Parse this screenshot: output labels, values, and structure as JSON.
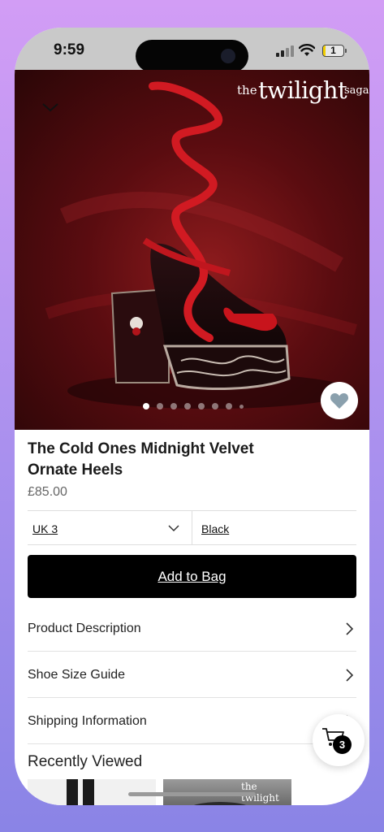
{
  "status_bar": {
    "time": "9:59",
    "battery": "1"
  },
  "brand": {
    "the": "the",
    "name": "twilight",
    "saga": "saga"
  },
  "gallery": {
    "dot_count": 8,
    "active_index": 0
  },
  "product": {
    "title": "The Cold Ones Midnight Velvet Ornate Heels",
    "price": "£85.00"
  },
  "options": {
    "size": "UK 3",
    "color": "Black"
  },
  "add_to_bag_label": "Add to Bag",
  "accordion": [
    {
      "label": "Product Description"
    },
    {
      "label": "Shoe Size Guide"
    },
    {
      "label": "Shipping Information"
    }
  ],
  "recently_viewed_title": "Recently Viewed",
  "recent_thumb_brand": "the twilight saga",
  "cart": {
    "count": "3"
  },
  "colors": {
    "accent": "#000000",
    "hero_bg": "#5a0c10",
    "ribbon": "#d11a22"
  }
}
